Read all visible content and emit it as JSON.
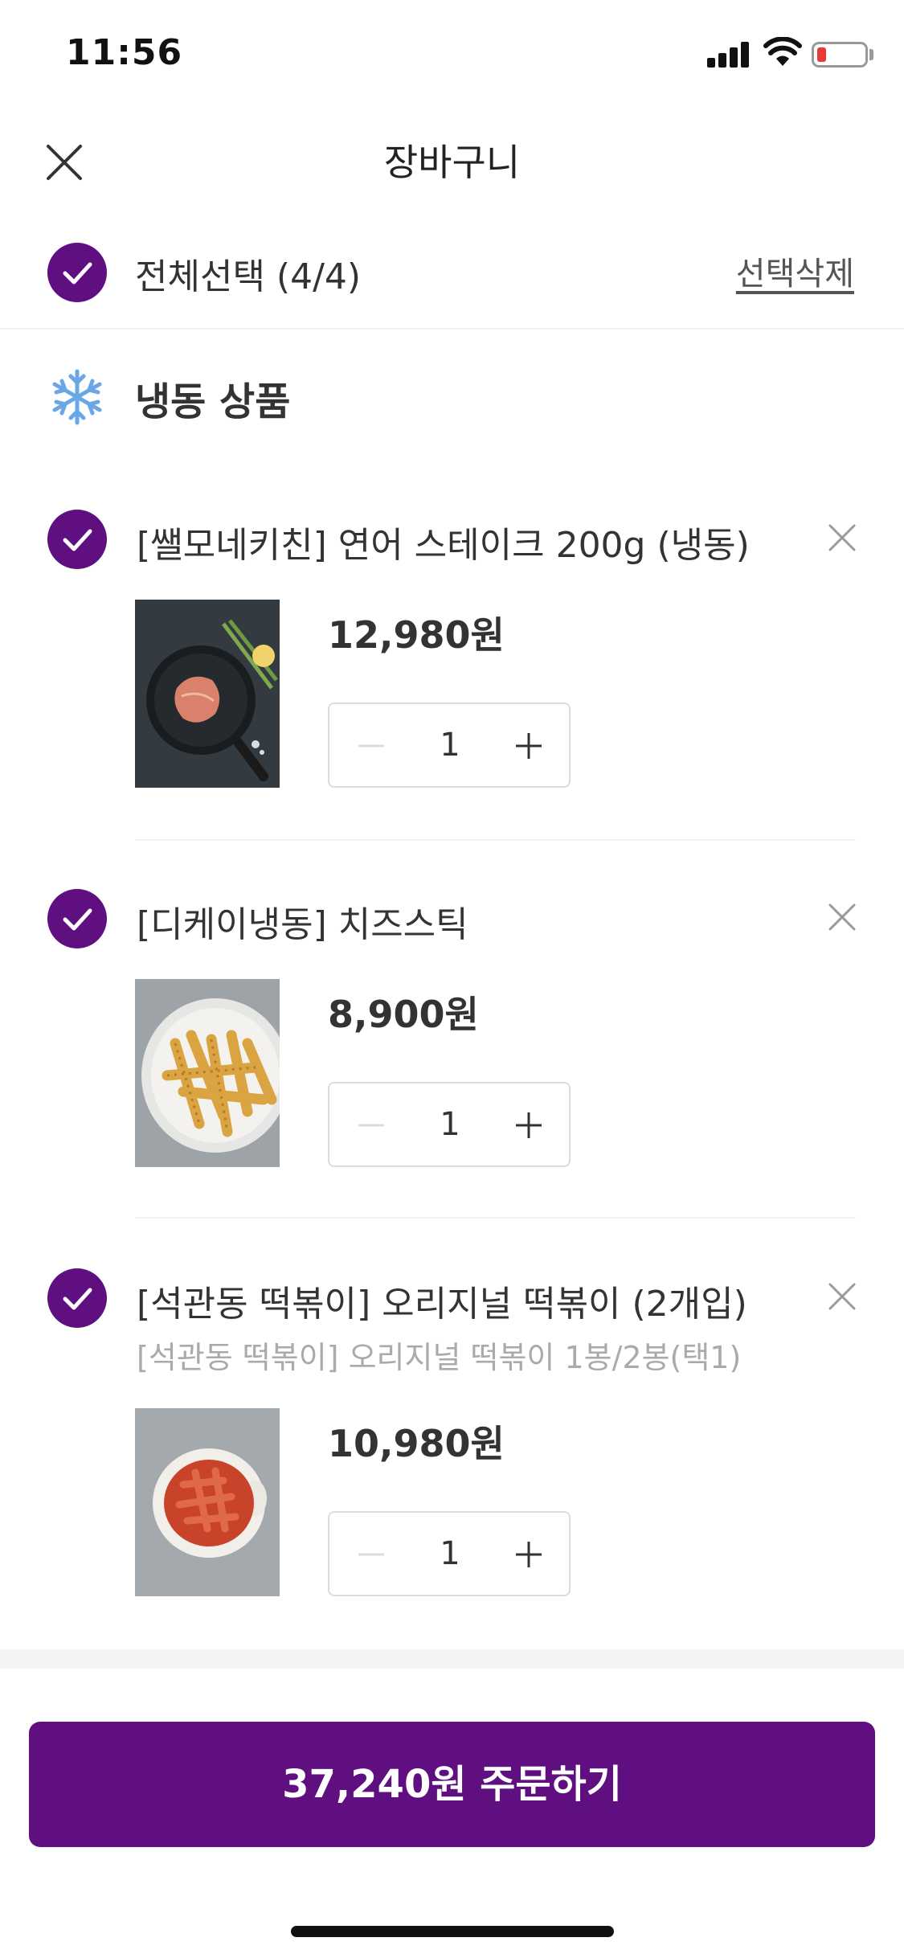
{
  "status_bar": {
    "time": "11:56"
  },
  "header": {
    "title": "장바구니"
  },
  "select_all": {
    "label": "전체선택 (4/4)",
    "delete_label": "선택삭제"
  },
  "section": {
    "title": "냉동 상품",
    "icon": "snowflake-icon"
  },
  "items": [
    {
      "name": "[쌜모네키친] 연어 스테이크 200g (냉동)",
      "option": "",
      "price": "12,980원",
      "qty": "1"
    },
    {
      "name": "[디케이냉동] 치즈스틱",
      "option": "",
      "price": "8,900원",
      "qty": "1"
    },
    {
      "name": "[석관동 떡볶이] 오리지널 떡볶이 (2개입)",
      "option": "[석관동 떡볶이] 오리지널 떡볶이 1봉/2봉(택1)",
      "price": "10,980원",
      "qty": "1"
    }
  ],
  "order_button": {
    "label": "37,240원 주문하기"
  },
  "colors": {
    "brand": "#5f0f80",
    "battery_low": "#e8393a"
  }
}
